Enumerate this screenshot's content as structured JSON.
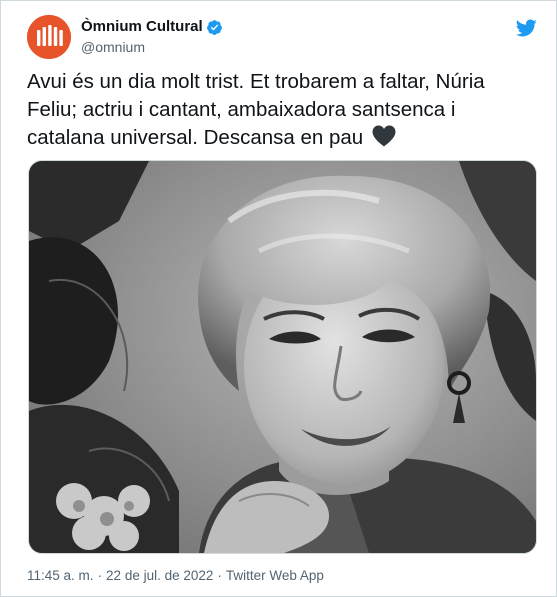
{
  "author": {
    "display_name": "Òmnium Cultural",
    "handle": "@omnium",
    "verified": true,
    "avatar_icon": "omnium-logo-icon",
    "avatar_color": "#e8542a"
  },
  "tweet": {
    "text": "Avui és un dia molt trist. Et trobarem a faltar, Núria Feliu; actriu i cantant, ambaixadora santsenca i catalana universal. Descansa en pau ",
    "emoji": "black-heart-icon",
    "photo": {
      "kind": "black-and-white portrait photograph"
    }
  },
  "meta": {
    "time": "11:45 a. m.",
    "separator": "·",
    "date": "22 de jul. de 2022",
    "source": "Twitter Web App"
  },
  "colors": {
    "text_primary": "#0f1419",
    "text_secondary": "#536471",
    "twitter_blue": "#1d9bf0",
    "border": "#cfd9de"
  }
}
